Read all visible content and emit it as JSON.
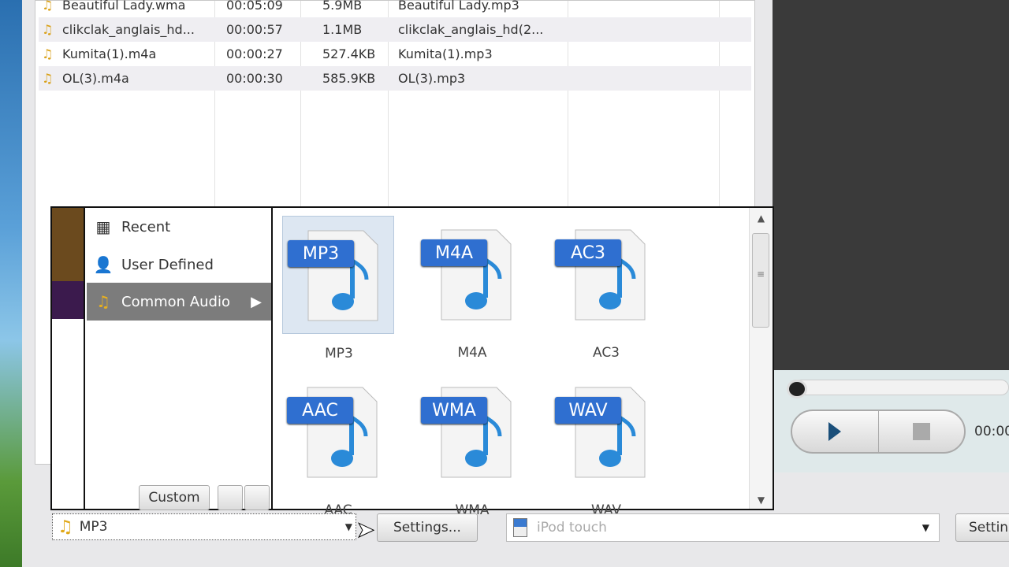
{
  "file_list": {
    "rows": [
      {
        "name": "Beautiful Lady.wma",
        "duration": "00:05:09",
        "size": "5.9MB",
        "output": "Beautiful Lady.mp3"
      },
      {
        "name": "clikclak_anglais_hd...",
        "duration": "00:00:57",
        "size": "1.1MB",
        "output": "clikclak_anglais_hd(2..."
      },
      {
        "name": "Kumita(1).m4a",
        "duration": "00:00:27",
        "size": "527.4KB",
        "output": "Kumita(1).mp3"
      },
      {
        "name": "OL(3).m4a",
        "duration": "00:00:30",
        "size": "585.9KB",
        "output": "OL(3).mp3"
      }
    ]
  },
  "format_popup": {
    "categories": [
      {
        "label": "Recent",
        "icon": "calendar-icon"
      },
      {
        "label": "User Defined",
        "icon": "user-icon"
      },
      {
        "label": "Common Audio",
        "icon": "music-note-icon",
        "selected": true
      }
    ],
    "custom_label": "Custom",
    "formats": [
      {
        "badge": "MP3",
        "label": "MP3",
        "selected": true
      },
      {
        "badge": "M4A",
        "label": "M4A"
      },
      {
        "badge": "AC3",
        "label": "AC3"
      },
      {
        "badge": "AAC",
        "label": "AAC"
      },
      {
        "badge": "WMA",
        "label": "WMA"
      },
      {
        "badge": "WAV",
        "label": "WAV"
      }
    ],
    "strip_colors": {
      "brown": "#6b4a1e",
      "purple": "#3b1a4d"
    }
  },
  "player": {
    "time": "00:00"
  },
  "bottom_bar": {
    "profile_value": "MP3",
    "settings_label": "Settings...",
    "device_placeholder": "iPod touch",
    "settings2_label": "Settin"
  },
  "accent": "#2f6fd0"
}
